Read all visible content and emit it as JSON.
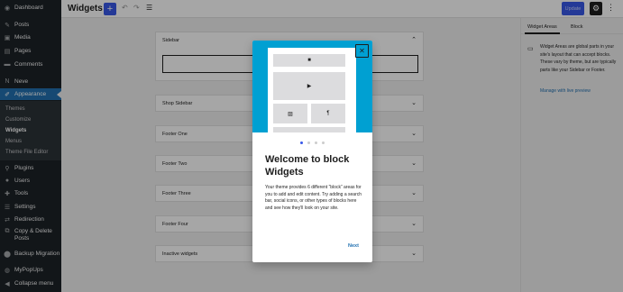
{
  "admin_menu": {
    "items": [
      {
        "label": "Dashboard",
        "icon": "dashboard-icon"
      },
      {
        "label": "Posts",
        "icon": "pin-icon"
      },
      {
        "label": "Media",
        "icon": "media-icon"
      },
      {
        "label": "Pages",
        "icon": "page-icon"
      },
      {
        "label": "Comments",
        "icon": "comment-icon"
      },
      {
        "label": "Neve",
        "icon": "neve-icon"
      },
      {
        "label": "Appearance",
        "icon": "brush-icon"
      },
      {
        "label": "Plugins",
        "icon": "plugin-icon"
      },
      {
        "label": "Users",
        "icon": "users-icon"
      },
      {
        "label": "Tools",
        "icon": "wrench-icon"
      },
      {
        "label": "Settings",
        "icon": "settings-icon"
      },
      {
        "label": "Redirection",
        "icon": "redirect-icon"
      },
      {
        "label": "Copy & Delete Posts",
        "icon": "copy-icon"
      },
      {
        "label": "Backup Migration",
        "icon": "backup-icon"
      },
      {
        "label": "MyPopUps",
        "icon": "popup-icon"
      },
      {
        "label": "Collapse menu",
        "icon": "collapse-icon"
      }
    ],
    "submenu": [
      "Themes",
      "Customize",
      "Widgets",
      "Menus",
      "Theme File Editor"
    ]
  },
  "header": {
    "title": "Widgets",
    "add_symbol": "+",
    "update_label": "Update"
  },
  "widget_areas": [
    {
      "title": "Sidebar",
      "expanded": true
    },
    {
      "title": "Shop Sidebar",
      "expanded": false
    },
    {
      "title": "Footer One",
      "expanded": false
    },
    {
      "title": "Footer Two",
      "expanded": false
    },
    {
      "title": "Footer Three",
      "expanded": false
    },
    {
      "title": "Footer Four",
      "expanded": false
    },
    {
      "title": "Inactive widgets",
      "expanded": false
    }
  ],
  "settings_panel": {
    "tabs": [
      "Widget Areas",
      "Block"
    ],
    "active_tab": "Widget Areas",
    "description": "Widget Areas are global parts in your site's layout that can accept blocks. These vary by theme, but are typically parts like your Sidebar or Footer.",
    "link": "Manage with live preview"
  },
  "modal": {
    "heading": "Welcome to block Widgets",
    "body": "Your theme provides 6 different “block” areas for you to add and edit content. Try adding a search bar, social icons, or other types of blocks here and see how they'll look on your site.",
    "next_label": "Next",
    "page_index": 1,
    "page_count": 4,
    "image_color": "#00a0d2"
  },
  "colors": {
    "accent": "#3858e9",
    "admin_bg": "#1d2327",
    "admin_current": "#2271b1"
  }
}
